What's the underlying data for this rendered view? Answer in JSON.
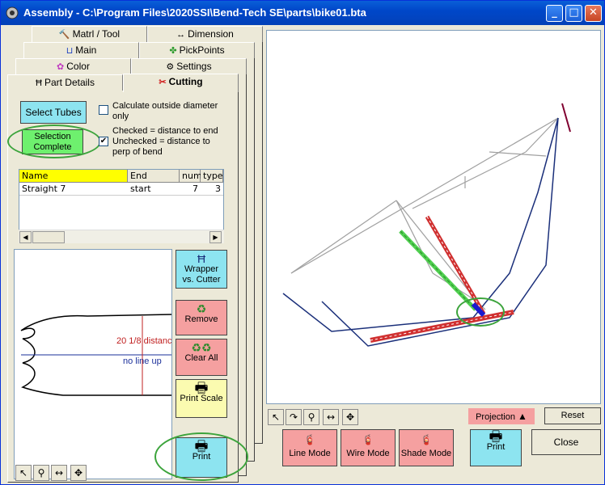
{
  "window": {
    "title": "Assembly - C:\\Program Files\\2020SSI\\Bend-Tech SE\\parts\\bike01.bta",
    "minimize": "_",
    "maximize": "□",
    "close": "✕"
  },
  "tabs": {
    "matrl_tool": "Matrl / Tool",
    "dimension": "Dimension",
    "main": "Main",
    "pickpoints": "PickPoints",
    "color": "Color",
    "settings": "Settings",
    "part_details": "Part Details",
    "cutting": "Cutting"
  },
  "cutting": {
    "select_tubes": "Select Tubes",
    "selection_complete_line1": "Selection",
    "selection_complete_line2": "Complete",
    "calc_od_line1": "Calculate outside diameter",
    "calc_od_line2": "only",
    "checked_line1": "Checked = distance to end",
    "checked_line2": "Unchecked = distance to",
    "checked_line3": "perp of bend",
    "calc_od_checked": false,
    "distance_checked": true
  },
  "grid": {
    "columns": [
      "Name",
      "End",
      "num",
      "type"
    ],
    "rows": [
      {
        "name": "Straight 7",
        "end": "start",
        "num": "7",
        "type": "3"
      }
    ]
  },
  "preview": {
    "distance_text": "20  1/8 distanc",
    "lineup_text": "no line up"
  },
  "side_buttons": {
    "wrapper_line1": "Wrapper",
    "wrapper_line2": "vs. Cutter",
    "remove": "Remove",
    "clear_all": "Clear All",
    "print_scale": "Print Scale",
    "print": "Print"
  },
  "view_toolbar": {
    "projection": "Projection",
    "reset": "Reset"
  },
  "bottom_buttons": {
    "line_mode": "Line Mode",
    "wire_mode": "Wire Mode",
    "shade_mode": "Shade Mode",
    "print": "Print",
    "close": "Close"
  },
  "colors": {
    "title_bar": "#0047c9",
    "grid_header_highlight": "#ffff00",
    "highlight_ellipse": "#3ca43c",
    "tube_red": "#d03030",
    "tube_green": "#50d050",
    "tube_navy": "#1a2f7a",
    "tube_gray": "#a0a0a0",
    "tube_maroon": "#800030"
  }
}
